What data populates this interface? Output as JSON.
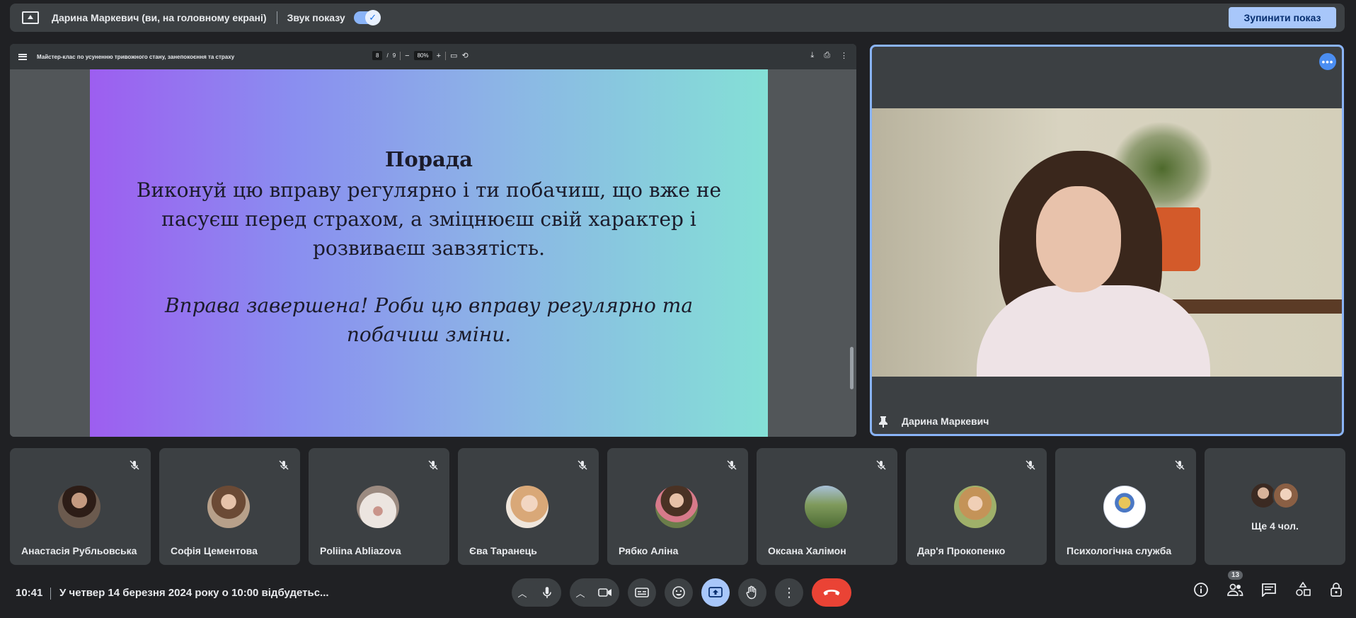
{
  "banner": {
    "presenter_label": "Дарина Маркевич (ви, на головному екрані)",
    "sound_label": "Звук показу",
    "sound_toggle_on": true,
    "stop_button": "Зупинити показ"
  },
  "pdf_viewer": {
    "doc_title": "Майстер-клас по усуненню тривожного стану, занепокоєння та страху",
    "current_page": "8",
    "page_separator": "/",
    "total_pages": "9",
    "zoom": "80%"
  },
  "slide": {
    "title": "Порада",
    "body": "Виконуй цю вправу регулярно і ти побачиш, що вже не пасуєш перед страхом, а зміцнюєш свій характер і розвиваєш завзятість.",
    "italic": "Вправа завершена! Роби цю вправу регулярно та побачиш зміни.",
    "colors": {
      "gradient_start": "#9d5ef0",
      "gradient_end": "#84e0d6"
    }
  },
  "speaker": {
    "name": "Дарина Маркевич",
    "pinned": true
  },
  "participants": [
    {
      "name": "Анастасія Рубльовська",
      "muted": true,
      "avatar_color": "#6b5a4e"
    },
    {
      "name": "Софія Цементова",
      "muted": true,
      "avatar_color": "#b7a08a"
    },
    {
      "name": "Poliina Abliazova",
      "muted": true,
      "avatar_color": "#d9c8be"
    },
    {
      "name": "Єва Таранець",
      "muted": true,
      "avatar_color": "#e8c3a5"
    },
    {
      "name": "Рябко Аліна",
      "muted": true,
      "avatar_color": "#6b7d4a"
    },
    {
      "name": "Оксана Халімон",
      "muted": true,
      "avatar_color": "#6f8c5a"
    },
    {
      "name": "Дар'я Прокопенко",
      "muted": true,
      "avatar_color": "#9fb06a"
    },
    {
      "name": "Психологічна служба",
      "muted": true,
      "avatar_color": "#ffffff"
    }
  ],
  "more_participants": {
    "label": "Ще 4 чол."
  },
  "bottom_bar": {
    "time": "10:41",
    "meeting_title": "У четвер 14 березня 2024 року о 10:00 відбудетьс...",
    "people_count": "13",
    "colors": {
      "end_call": "#ea4335",
      "present_active": "#a8c7fa"
    }
  }
}
